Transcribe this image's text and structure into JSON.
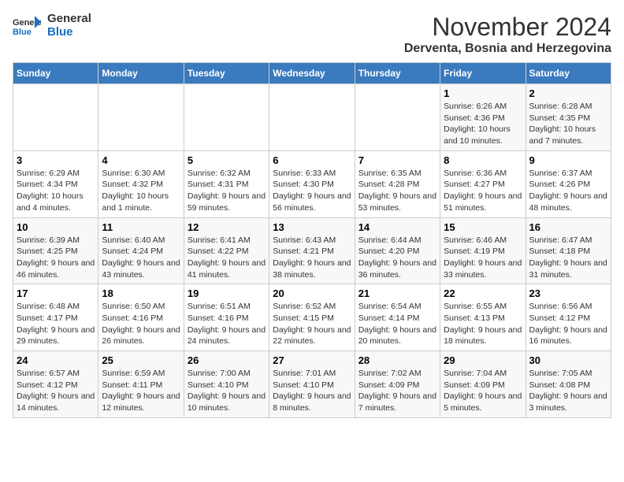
{
  "header": {
    "logo_general": "General",
    "logo_blue": "Blue",
    "month": "November 2024",
    "location": "Derventa, Bosnia and Herzegovina"
  },
  "weekdays": [
    "Sunday",
    "Monday",
    "Tuesday",
    "Wednesday",
    "Thursday",
    "Friday",
    "Saturday"
  ],
  "weeks": [
    [
      {
        "day": "",
        "info": ""
      },
      {
        "day": "",
        "info": ""
      },
      {
        "day": "",
        "info": ""
      },
      {
        "day": "",
        "info": ""
      },
      {
        "day": "",
        "info": ""
      },
      {
        "day": "1",
        "info": "Sunrise: 6:26 AM\nSunset: 4:36 PM\nDaylight: 10 hours and 10 minutes."
      },
      {
        "day": "2",
        "info": "Sunrise: 6:28 AM\nSunset: 4:35 PM\nDaylight: 10 hours and 7 minutes."
      }
    ],
    [
      {
        "day": "3",
        "info": "Sunrise: 6:29 AM\nSunset: 4:34 PM\nDaylight: 10 hours and 4 minutes."
      },
      {
        "day": "4",
        "info": "Sunrise: 6:30 AM\nSunset: 4:32 PM\nDaylight: 10 hours and 1 minute."
      },
      {
        "day": "5",
        "info": "Sunrise: 6:32 AM\nSunset: 4:31 PM\nDaylight: 9 hours and 59 minutes."
      },
      {
        "day": "6",
        "info": "Sunrise: 6:33 AM\nSunset: 4:30 PM\nDaylight: 9 hours and 56 minutes."
      },
      {
        "day": "7",
        "info": "Sunrise: 6:35 AM\nSunset: 4:28 PM\nDaylight: 9 hours and 53 minutes."
      },
      {
        "day": "8",
        "info": "Sunrise: 6:36 AM\nSunset: 4:27 PM\nDaylight: 9 hours and 51 minutes."
      },
      {
        "day": "9",
        "info": "Sunrise: 6:37 AM\nSunset: 4:26 PM\nDaylight: 9 hours and 48 minutes."
      }
    ],
    [
      {
        "day": "10",
        "info": "Sunrise: 6:39 AM\nSunset: 4:25 PM\nDaylight: 9 hours and 46 minutes."
      },
      {
        "day": "11",
        "info": "Sunrise: 6:40 AM\nSunset: 4:24 PM\nDaylight: 9 hours and 43 minutes."
      },
      {
        "day": "12",
        "info": "Sunrise: 6:41 AM\nSunset: 4:22 PM\nDaylight: 9 hours and 41 minutes."
      },
      {
        "day": "13",
        "info": "Sunrise: 6:43 AM\nSunset: 4:21 PM\nDaylight: 9 hours and 38 minutes."
      },
      {
        "day": "14",
        "info": "Sunrise: 6:44 AM\nSunset: 4:20 PM\nDaylight: 9 hours and 36 minutes."
      },
      {
        "day": "15",
        "info": "Sunrise: 6:46 AM\nSunset: 4:19 PM\nDaylight: 9 hours and 33 minutes."
      },
      {
        "day": "16",
        "info": "Sunrise: 6:47 AM\nSunset: 4:18 PM\nDaylight: 9 hours and 31 minutes."
      }
    ],
    [
      {
        "day": "17",
        "info": "Sunrise: 6:48 AM\nSunset: 4:17 PM\nDaylight: 9 hours and 29 minutes."
      },
      {
        "day": "18",
        "info": "Sunrise: 6:50 AM\nSunset: 4:16 PM\nDaylight: 9 hours and 26 minutes."
      },
      {
        "day": "19",
        "info": "Sunrise: 6:51 AM\nSunset: 4:16 PM\nDaylight: 9 hours and 24 minutes."
      },
      {
        "day": "20",
        "info": "Sunrise: 6:52 AM\nSunset: 4:15 PM\nDaylight: 9 hours and 22 minutes."
      },
      {
        "day": "21",
        "info": "Sunrise: 6:54 AM\nSunset: 4:14 PM\nDaylight: 9 hours and 20 minutes."
      },
      {
        "day": "22",
        "info": "Sunrise: 6:55 AM\nSunset: 4:13 PM\nDaylight: 9 hours and 18 minutes."
      },
      {
        "day": "23",
        "info": "Sunrise: 6:56 AM\nSunset: 4:12 PM\nDaylight: 9 hours and 16 minutes."
      }
    ],
    [
      {
        "day": "24",
        "info": "Sunrise: 6:57 AM\nSunset: 4:12 PM\nDaylight: 9 hours and 14 minutes."
      },
      {
        "day": "25",
        "info": "Sunrise: 6:59 AM\nSunset: 4:11 PM\nDaylight: 9 hours and 12 minutes."
      },
      {
        "day": "26",
        "info": "Sunrise: 7:00 AM\nSunset: 4:10 PM\nDaylight: 9 hours and 10 minutes."
      },
      {
        "day": "27",
        "info": "Sunrise: 7:01 AM\nSunset: 4:10 PM\nDaylight: 9 hours and 8 minutes."
      },
      {
        "day": "28",
        "info": "Sunrise: 7:02 AM\nSunset: 4:09 PM\nDaylight: 9 hours and 7 minutes."
      },
      {
        "day": "29",
        "info": "Sunrise: 7:04 AM\nSunset: 4:09 PM\nDaylight: 9 hours and 5 minutes."
      },
      {
        "day": "30",
        "info": "Sunrise: 7:05 AM\nSunset: 4:08 PM\nDaylight: 9 hours and 3 minutes."
      }
    ]
  ]
}
